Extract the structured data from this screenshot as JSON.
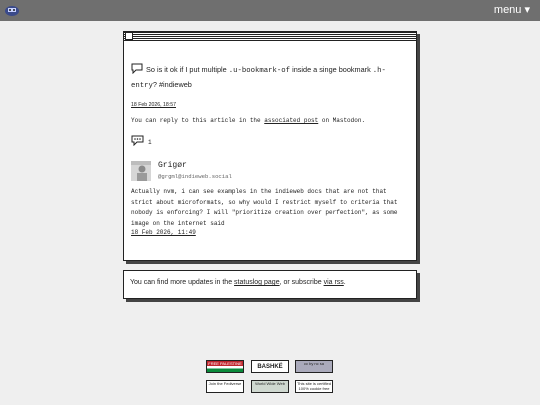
{
  "header": {
    "menu_label": "menu ▾"
  },
  "post": {
    "text_1": "So is it ok if I put multiple ",
    "code_1": ".u-bookmark-of",
    "text_2": " inside a singe bookmark ",
    "code_2": ".h-entry",
    "text_3": "? #indieweb",
    "date": "18 Feb 2026, 18:57",
    "reply_prefix": "You can reply to this article in the ",
    "reply_link": "associated post",
    "reply_suffix": " on Mastodon.",
    "comment_count": "1"
  },
  "comment": {
    "author": "Grigør",
    "handle": "@grgml@indieweb.social",
    "body": "Actually nvm, i can see examples in the indieweb docs that are not that strict about microformats, so why would I restrict myself to criteria that nobody is enforcing? I will \"prioritize creation over perfection\", as some image on the internet said",
    "date": "18 Feb 2026, 11:49"
  },
  "footer": {
    "prefix": "You can find more updates in the ",
    "statuslog_link": "statuslog page",
    "middle": ", or subscribe ",
    "rss_link": "via rss",
    "suffix": "."
  },
  "badges": [
    {
      "name": "palestine-badge",
      "text": "FREE PALESTINE"
    },
    {
      "name": "bashke-badge",
      "text": "BASHKË"
    },
    {
      "name": "cc-badge",
      "text": "cc by nc sa"
    },
    {
      "name": "fediverse-badge",
      "text": "Join the Fediverse"
    },
    {
      "name": "worldwideweb-badge",
      "text": "World Wide Web"
    },
    {
      "name": "no-ai-badge",
      "text": "This site is certified 100% cookie free"
    }
  ],
  "colors": {
    "topbar": "#6f6f6f",
    "page": "#efefef",
    "card": "#ffffff"
  }
}
